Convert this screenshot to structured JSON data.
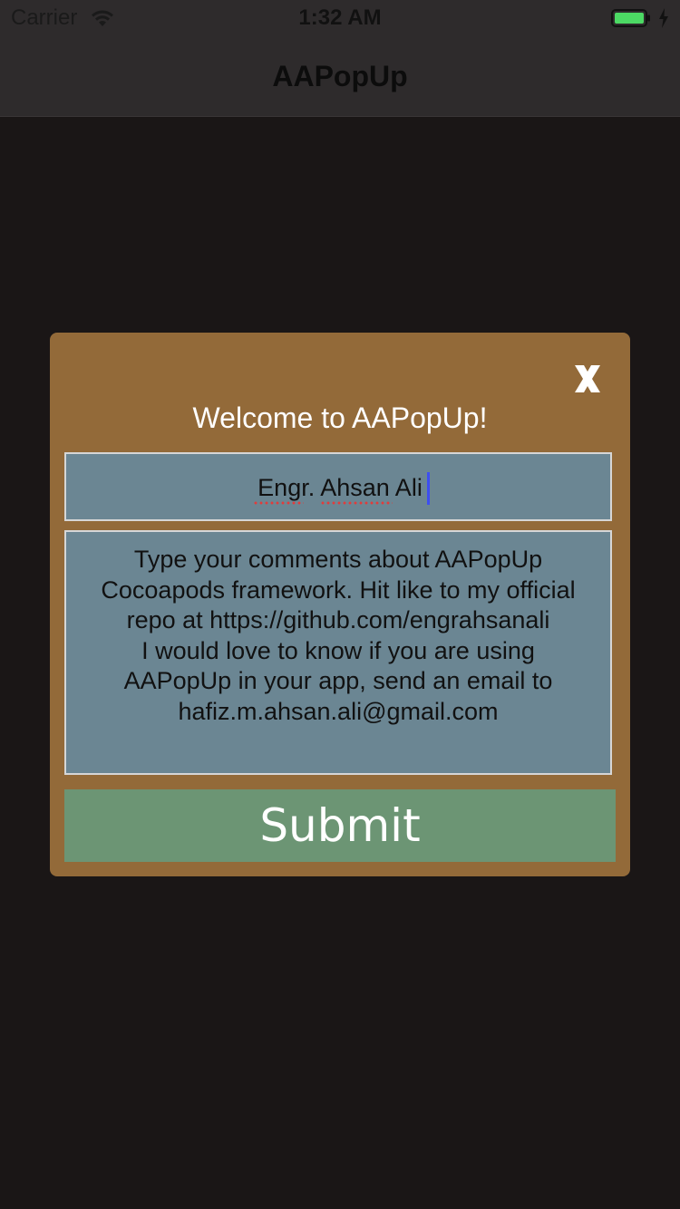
{
  "status_bar": {
    "carrier": "Carrier",
    "time": "1:32 AM",
    "battery_color": "#4cd964"
  },
  "nav": {
    "title": "AAPopUp"
  },
  "popup": {
    "background_color": "#936a39",
    "close_icon": "close-x-icon",
    "title": "Welcome to AAPopUp!",
    "name_field": {
      "value": "Engr. Ahsan Ali",
      "parts": [
        "Engr",
        ". ",
        "Ahsan",
        " Ali"
      ]
    },
    "comments_field": {
      "value": "Type your comments about AAPopUp\nCocoapods framework. Hit like to my official\nrepo at https://github.com/engrahsanali\nI would love to know if you are using\nAAPopUp in your app, send an email to\nhafiz.m.ahsan.ali@gmail.com"
    },
    "submit_label": "Submit",
    "submit_color": "#6c9574",
    "field_color": "#6b8693"
  }
}
